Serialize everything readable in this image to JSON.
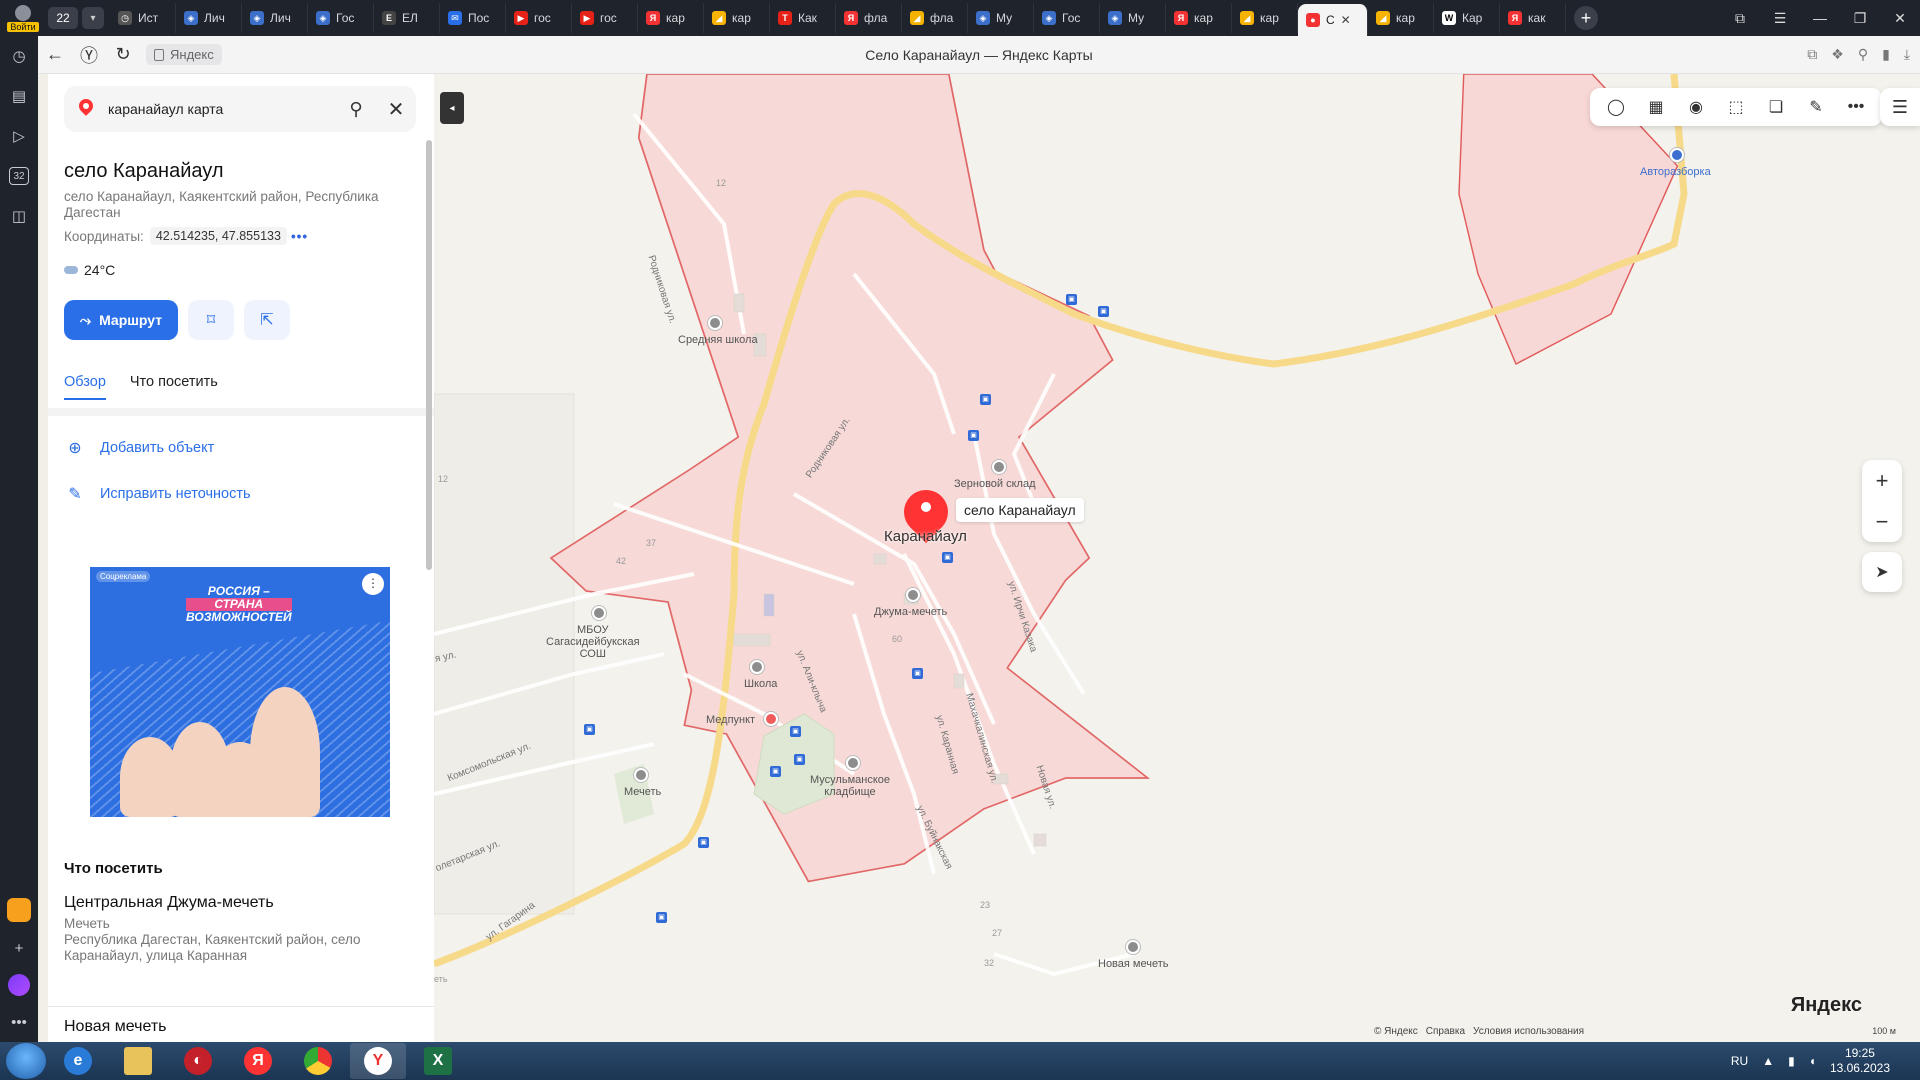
{
  "browser": {
    "login_label": "Войти",
    "tab_count": "22",
    "tabs": [
      {
        "label": "Ист",
        "color": "#555555",
        "glyph": "◷"
      },
      {
        "label": "Лич",
        "color": "#3b6fc9",
        "glyph": "◈"
      },
      {
        "label": "Лич",
        "color": "#3b6fc9",
        "glyph": "◈"
      },
      {
        "label": "Гос",
        "color": "#3b6fc9",
        "glyph": "◈"
      },
      {
        "label": "ЕЛ",
        "color": "#444444",
        "glyph": "Е"
      },
      {
        "label": "Пос",
        "color": "#2b6fe8",
        "glyph": "✉"
      },
      {
        "label": "гос",
        "color": "#e62117",
        "glyph": "▶"
      },
      {
        "label": "гос",
        "color": "#e62117",
        "glyph": "▶"
      },
      {
        "label": "кар",
        "color": "#f33333",
        "glyph": "Я"
      },
      {
        "label": "кар",
        "color": "#f5b300",
        "glyph": "◢"
      },
      {
        "label": "Как",
        "color": "#e62117",
        "glyph": "T"
      },
      {
        "label": "фла",
        "color": "#f33333",
        "glyph": "Я"
      },
      {
        "label": "фла",
        "color": "#f5b300",
        "glyph": "◢"
      },
      {
        "label": "Му",
        "color": "#3b6fc9",
        "glyph": "◈"
      },
      {
        "label": "Гос",
        "color": "#3b6fc9",
        "glyph": "◈"
      },
      {
        "label": "Му",
        "color": "#3b6fc9",
        "glyph": "◈"
      },
      {
        "label": "кар",
        "color": "#f33333",
        "glyph": "Я"
      },
      {
        "label": "кар",
        "color": "#f5b300",
        "glyph": "◢"
      },
      {
        "label": "С",
        "color": "#f33333",
        "glyph": "●",
        "active": true
      },
      {
        "label": "кар",
        "color": "#f5b300",
        "glyph": "◢"
      },
      {
        "label": "Кар",
        "color": "#ffffff",
        "glyph": "W"
      },
      {
        "label": "как",
        "color": "#f33333",
        "glyph": "Я"
      }
    ],
    "domain": "Яндекс",
    "page_title": "Село Каранайаул — Яндекс Карты"
  },
  "search": {
    "query": "каранайаул карта"
  },
  "place": {
    "title": "село Каранайаул",
    "address": "село Каранайаул, Каякентский район, Республика Дагестан",
    "coords_label": "Координаты:",
    "coords_value": "42.514235, 47.855133",
    "weather": "24°C",
    "route_button": "Маршрут"
  },
  "tabs": {
    "overview": "Обзор",
    "visit": "Что посетить"
  },
  "actions": {
    "add_object": "Добавить объект",
    "fix_error": "Исправить неточность"
  },
  "ad": {
    "label": "Соцреклама",
    "slogan_1": "РОССИЯ –",
    "slogan_2": "СТРАНА",
    "slogan_3": "ВОЗМОЖНОСТЕЙ"
  },
  "visit_section": {
    "title": "Что посетить",
    "places": [
      {
        "name": "Центральная Джума-мечеть",
        "type": "Мечеть",
        "address": "Республика Дагестан, Каякентский район, село Каранайаул, улица Каранная"
      },
      {
        "name": "Новая мечеть",
        "type": "",
        "address": ""
      }
    ]
  },
  "map": {
    "marker_label": "село Каранайаул",
    "town_label": "Каранайаул",
    "pois": {
      "school_mid": "Средняя школа",
      "granary": "Зерновой склад",
      "mosque_juma": "Джума-мечеть",
      "mbou": "МБОУ\nСагасидейбукская\nСОШ",
      "school": "Школа",
      "medpunkt": "Медпункт",
      "cemetery": "Мусульманское\nкладбище",
      "mosque": "Мечеть",
      "new_mosque": "Новая мечеть",
      "autoparts": "Авторазборка"
    },
    "streets": {
      "rodnikovaya_1": "Родниковая ул.",
      "rodnikovaya_2": "Родниковая ул.",
      "irchi": "ул. Ирчи Казака",
      "alikilicha": "ул. Али-клыча",
      "karannaya": "ул. Каранная",
      "makhachkalinskaya": "Махачкалинская ул.",
      "novaya": "Новая ул.",
      "buinakskaya": "ул. Буйнакская",
      "komsomolskaya": "Комсомольская ул.",
      "proletarskaya": "олетарская ул.",
      "gagarina": "ул. Гагарина",
      "ya_ul": "я ул."
    },
    "numbers": {
      "n12a": "12",
      "n12b": "12",
      "n37": "37",
      "n42": "42",
      "n60": "60",
      "n23": "23",
      "n27": "27",
      "n32": "32",
      "n_et": "еть"
    },
    "copyright": {
      "yandex": "© Яндекс",
      "help": "Справка",
      "terms": "Условия использования"
    },
    "scale": "100 м",
    "logo": "Яндекс"
  },
  "taskbar": {
    "lang": "RU",
    "time": "19:25",
    "date": "13.06.2023"
  },
  "colors": {
    "accent": "#2b6fe8",
    "marker": "#ff3333",
    "area_fill": "#f8d8d6",
    "area_stroke": "#e05a5a",
    "road": "#f7d98a"
  }
}
